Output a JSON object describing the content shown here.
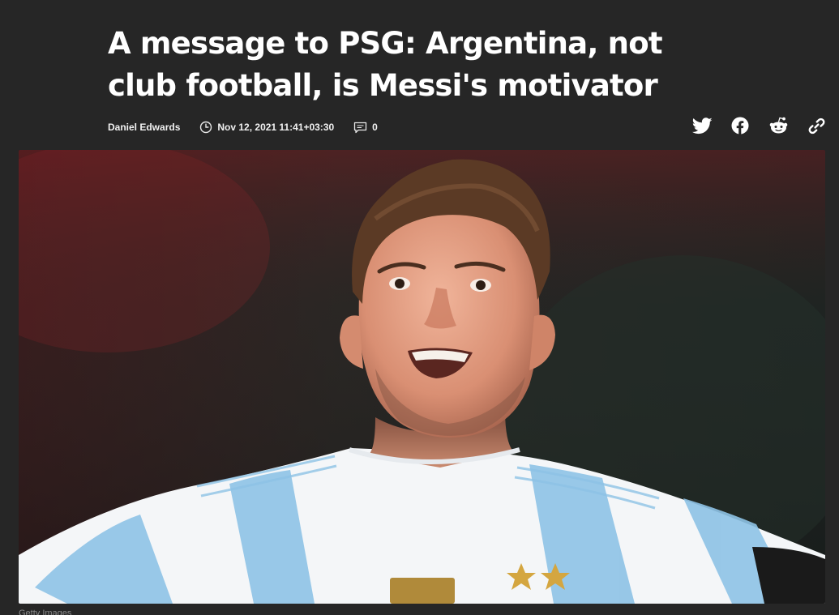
{
  "article": {
    "title": "A message to PSG: Argentina, not club football, is Messi's motivator",
    "author": "Daniel Edwards",
    "published": "Nov 12, 2021 11:41+03:30",
    "comment_count": "0",
    "image_caption": "Getty Images"
  },
  "icons": {
    "clock": "clock-icon",
    "comment": "comment-icon",
    "twitter": "twitter-icon",
    "facebook": "facebook-icon",
    "reddit": "reddit-icon",
    "link": "link-icon"
  },
  "colors": {
    "background": "#262626",
    "text": "#ffffff",
    "caption": "#8a8a8a",
    "jersey_blue": "#8ec3e6",
    "jersey_white": "#f4f6f8"
  }
}
